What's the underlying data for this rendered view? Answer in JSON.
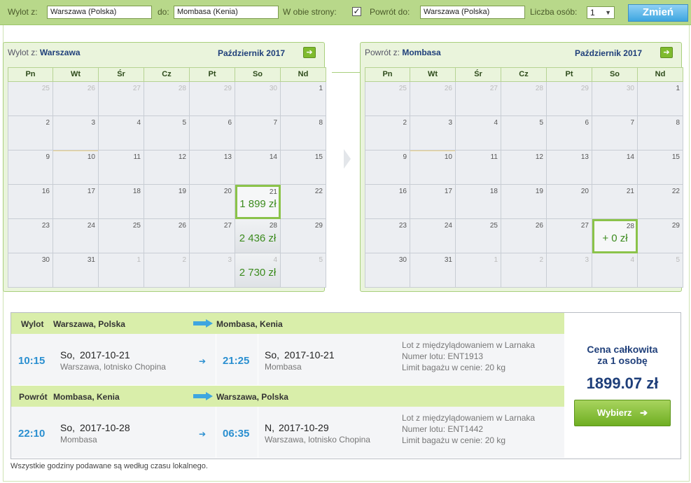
{
  "search": {
    "from_label": "Wylot z:",
    "from_value": "Warszawa (Polska)",
    "to_label": "do:",
    "to_value": "Mombasa (Kenia)",
    "roundtrip_label": "W obie strony:",
    "roundtrip_checked": "✓",
    "return_label": "Powrót do:",
    "return_value": "Warszawa (Polska)",
    "people_label": "Liczba osób:",
    "people_value": "1",
    "submit_label": "Zmień"
  },
  "weekdays": [
    "Pn",
    "Wt",
    "Śr",
    "Cz",
    "Pt",
    "So",
    "Nd"
  ],
  "outbound_calendar": {
    "title_prefix": "Wylot z:",
    "city": "Warszawa",
    "month": "Październik 2017",
    "weeks": [
      [
        {
          "d": "25",
          "m": true
        },
        {
          "d": "26",
          "m": true
        },
        {
          "d": "27",
          "m": true
        },
        {
          "d": "28",
          "m": true
        },
        {
          "d": "29",
          "m": true
        },
        {
          "d": "30",
          "m": true
        },
        {
          "d": "1"
        }
      ],
      [
        {
          "d": "2"
        },
        {
          "d": "3"
        },
        {
          "d": "4"
        },
        {
          "d": "5"
        },
        {
          "d": "6"
        },
        {
          "d": "7"
        },
        {
          "d": "8"
        }
      ],
      [
        {
          "d": "9"
        },
        {
          "d": "10",
          "today": true
        },
        {
          "d": "11"
        },
        {
          "d": "12"
        },
        {
          "d": "13"
        },
        {
          "d": "14"
        },
        {
          "d": "15"
        }
      ],
      [
        {
          "d": "16"
        },
        {
          "d": "17"
        },
        {
          "d": "18"
        },
        {
          "d": "19"
        },
        {
          "d": "20"
        },
        {
          "d": "21",
          "price": "1 899 zł",
          "selected": true
        },
        {
          "d": "22"
        }
      ],
      [
        {
          "d": "23"
        },
        {
          "d": "24"
        },
        {
          "d": "25"
        },
        {
          "d": "26"
        },
        {
          "d": "27"
        },
        {
          "d": "28",
          "price": "2 436 zł"
        },
        {
          "d": "29"
        }
      ],
      [
        {
          "d": "30"
        },
        {
          "d": "31"
        },
        {
          "d": "1",
          "m": true
        },
        {
          "d": "2",
          "m": true
        },
        {
          "d": "3",
          "m": true
        },
        {
          "d": "4",
          "m": true,
          "price": "2 730 zł"
        },
        {
          "d": "5",
          "m": true
        }
      ]
    ]
  },
  "return_calendar": {
    "title_prefix": "Powrót z:",
    "city": "Mombasa",
    "month": "Październik 2017",
    "weeks": [
      [
        {
          "d": "25",
          "m": true
        },
        {
          "d": "26",
          "m": true
        },
        {
          "d": "27",
          "m": true
        },
        {
          "d": "28",
          "m": true
        },
        {
          "d": "29",
          "m": true
        },
        {
          "d": "30",
          "m": true
        },
        {
          "d": "1"
        }
      ],
      [
        {
          "d": "2"
        },
        {
          "d": "3"
        },
        {
          "d": "4"
        },
        {
          "d": "5"
        },
        {
          "d": "6"
        },
        {
          "d": "7"
        },
        {
          "d": "8"
        }
      ],
      [
        {
          "d": "9"
        },
        {
          "d": "10",
          "today": true
        },
        {
          "d": "11"
        },
        {
          "d": "12"
        },
        {
          "d": "13"
        },
        {
          "d": "14"
        },
        {
          "d": "15"
        }
      ],
      [
        {
          "d": "16"
        },
        {
          "d": "17"
        },
        {
          "d": "18"
        },
        {
          "d": "19"
        },
        {
          "d": "20"
        },
        {
          "d": "21"
        },
        {
          "d": "22"
        }
      ],
      [
        {
          "d": "23"
        },
        {
          "d": "24"
        },
        {
          "d": "25"
        },
        {
          "d": "26"
        },
        {
          "d": "27"
        },
        {
          "d": "28",
          "price": "+ 0 zł",
          "selected": true
        },
        {
          "d": "29"
        }
      ],
      [
        {
          "d": "30"
        },
        {
          "d": "31"
        },
        {
          "d": "1",
          "m": true
        },
        {
          "d": "2",
          "m": true
        },
        {
          "d": "3",
          "m": true
        },
        {
          "d": "4",
          "m": true
        },
        {
          "d": "5",
          "m": true
        }
      ]
    ]
  },
  "outbound": {
    "label": "Wylot",
    "from": "Warszawa, Polska",
    "to": "Mombasa, Kenia",
    "dep_time": "10:15",
    "dep_day": "So,",
    "dep_date": "2017-10-21",
    "dep_place": "Warszawa, lotnisko Chopina",
    "arr_time": "21:25",
    "arr_day": "So,",
    "arr_date": "2017-10-21",
    "arr_place": "Mombasa",
    "info1": "Lot z międzylądowaniem w Larnaka",
    "info2": "Numer lotu: ENT1913",
    "info3": "Limit bagażu w cenie: 20 kg"
  },
  "inbound": {
    "label": "Powrót",
    "from": "Mombasa, Kenia",
    "to": "Warszawa, Polska",
    "dep_time": "22:10",
    "dep_day": "So,",
    "dep_date": "2017-10-28",
    "dep_place": "Mombasa",
    "arr_time": "06:35",
    "arr_day": "N,",
    "arr_date": "2017-10-29",
    "arr_place": "Warszawa, lotnisko Chopina",
    "info1": "Lot z międzylądowaniem w Larnaka",
    "info2": "Numer lotu: ENT1442",
    "info3": "Limit bagażu w cenie: 20 kg"
  },
  "price": {
    "label_line1": "Cena całkowita",
    "label_line2": "za 1 osobę",
    "amount": "1899.07 zł",
    "select_label": "Wybierz"
  },
  "note": "Wszystkie godziny podawane są według czasu lokalnego."
}
